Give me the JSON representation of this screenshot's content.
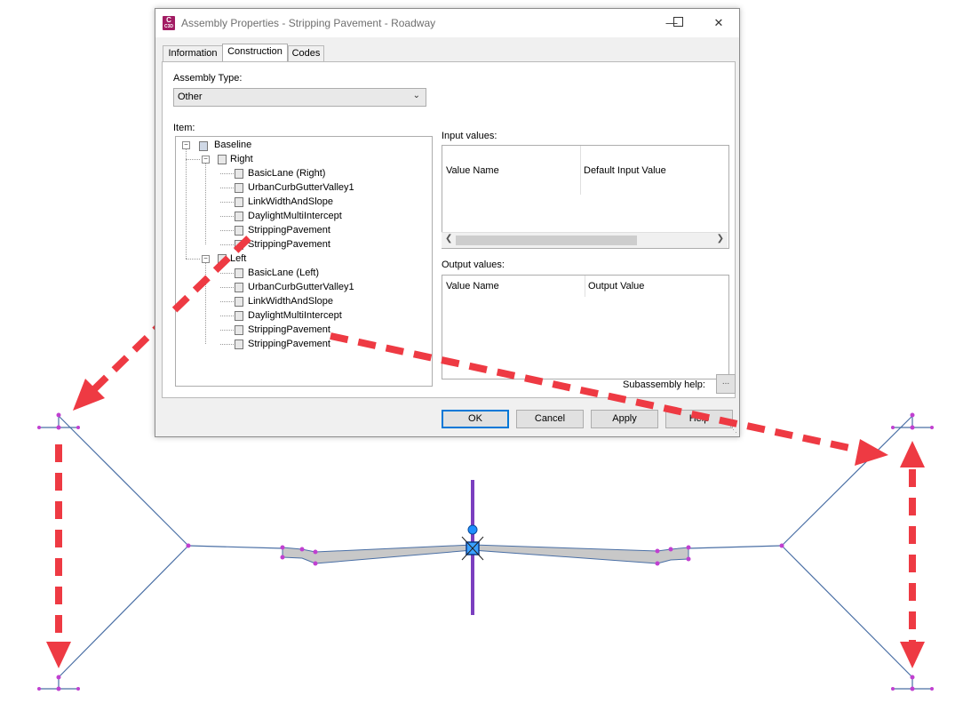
{
  "window": {
    "title": "Assembly Properties - Stripping Pavement - Roadway",
    "app_icon_letter": "C",
    "app_icon_sub": "C3D",
    "minimize_icon": "minimize-icon",
    "maximize_icon": "maximize-icon",
    "close_icon": "close-icon"
  },
  "tabs": [
    {
      "label": "Information",
      "active": false
    },
    {
      "label": "Construction",
      "active": true
    },
    {
      "label": "Codes",
      "active": false
    }
  ],
  "construction": {
    "assembly_type_label": "Assembly Type:",
    "assembly_type_value": "Other",
    "item_label": "Item:",
    "tree": {
      "root": "Baseline",
      "right_group": "Right",
      "right_items": [
        "BasicLane (Right)",
        "UrbanCurbGutterValley1",
        "LinkWidthAndSlope",
        "DaylightMultiIntercept",
        "StrippingPavement",
        "StrippingPavement"
      ],
      "left_group": "Left",
      "left_items": [
        "BasicLane (Left)",
        "UrbanCurbGutterValley1",
        "LinkWidthAndSlope",
        "DaylightMultiIntercept",
        "StrippingPavement",
        "StrippingPavement"
      ]
    },
    "input_values_label": "Input values:",
    "input_columns": [
      "Value Name",
      "Default Input Value"
    ],
    "output_values_label": "Output values:",
    "output_columns": [
      "Value Name",
      "Output Value"
    ],
    "subassembly_help_label": "Subassembly help:",
    "subassembly_help_button": "..."
  },
  "buttons": {
    "ok": "OK",
    "cancel": "Cancel",
    "apply": "Apply",
    "help": "Help"
  },
  "colors": {
    "annotation_arrow": "#ee3a43",
    "assembly_line": "#4a6fa5",
    "baseline_marker": "#7b3fbf",
    "point_marker": "#c040d0",
    "pavement_fill": "#c8c8c8",
    "accent": "#0078d7"
  }
}
